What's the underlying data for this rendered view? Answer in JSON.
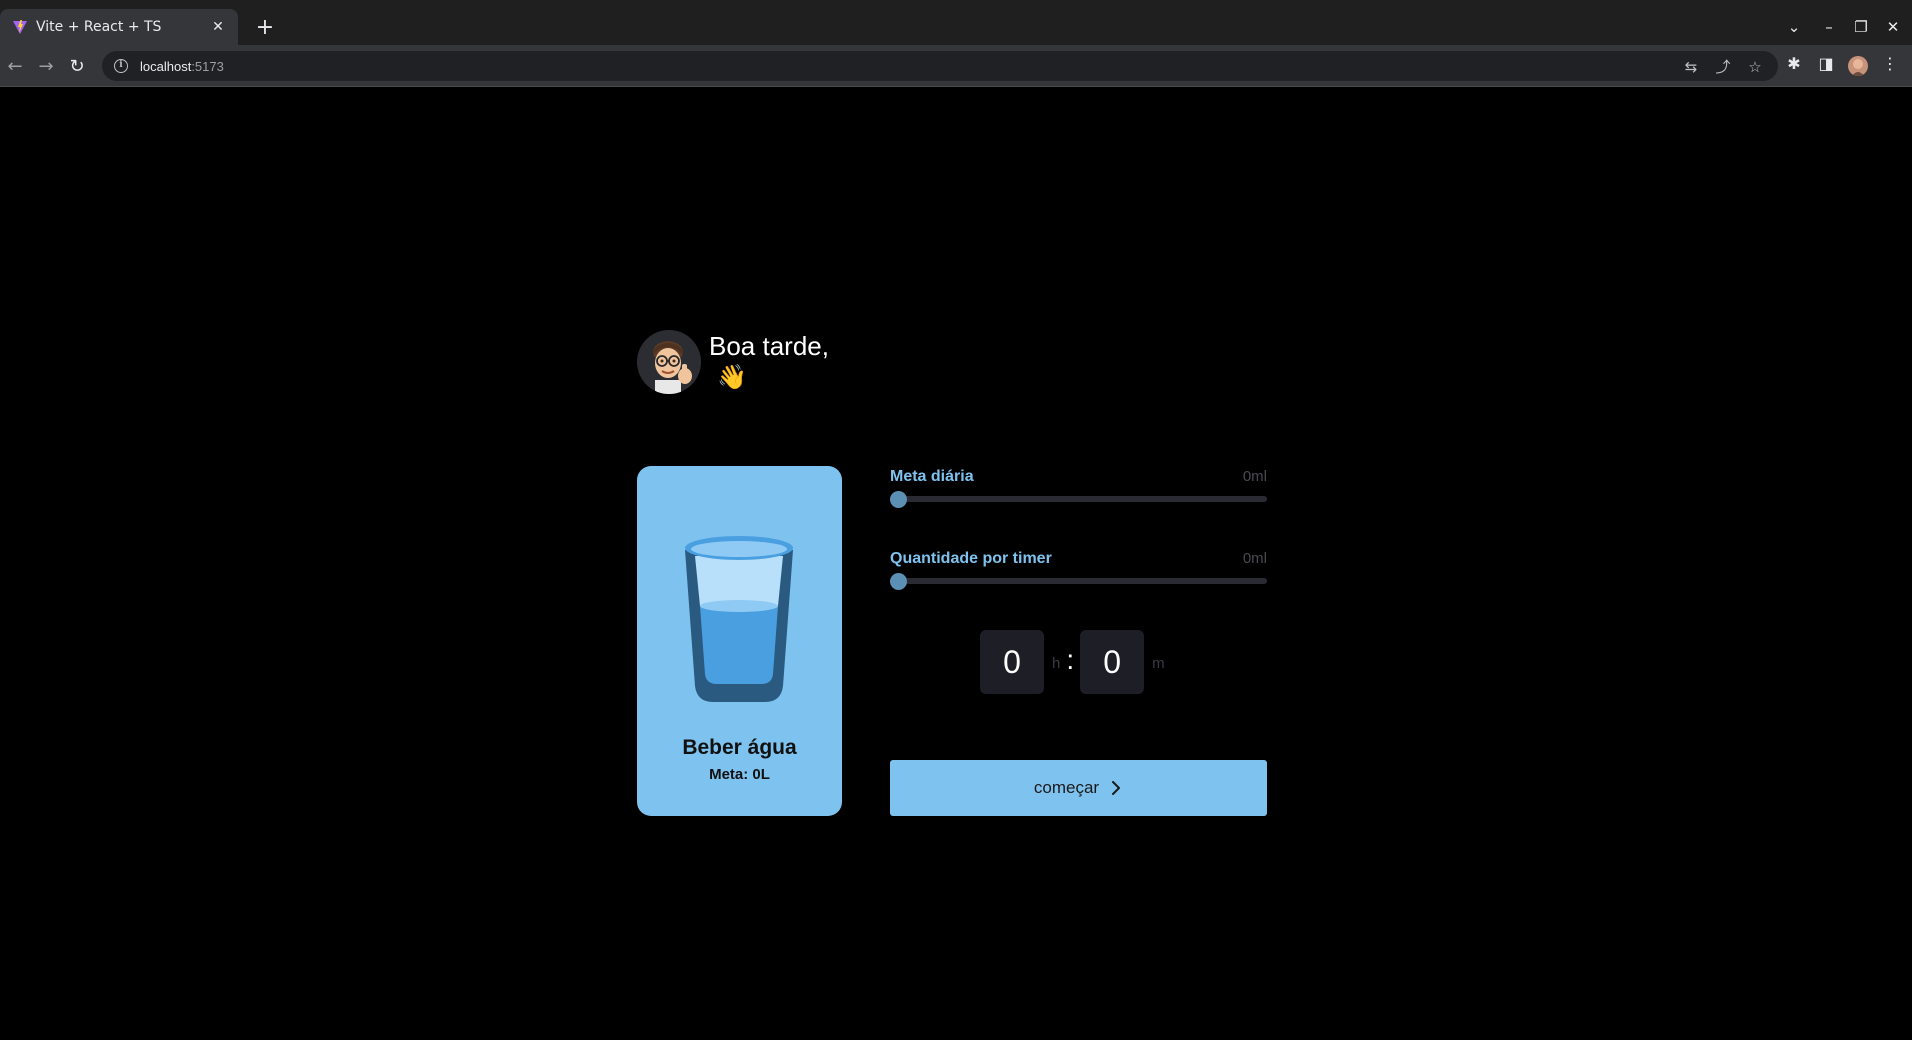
{
  "browser": {
    "tab_title": "Vite + React + TS",
    "tab_close": "✕",
    "new_tab": "+",
    "url_host": "localhost",
    "url_port": ":5173"
  },
  "app": {
    "greeting": "Boa tarde,",
    "wave_emoji": "👋",
    "card": {
      "title": "Beber água",
      "goal": "Meta: 0L",
      "color": "#7ec3ef"
    },
    "daily_goal": {
      "label": "Meta diária",
      "value": "0ml",
      "level": 0
    },
    "per_timer": {
      "label": "Quantidade por timer",
      "value": "0ml",
      "level": 0
    },
    "timer": {
      "hours": "0",
      "hours_unit": "h",
      "separator": ":",
      "minutes": "0",
      "minutes_unit": "m"
    },
    "start_button": "começar",
    "accent_color": "#7ec3ef"
  }
}
